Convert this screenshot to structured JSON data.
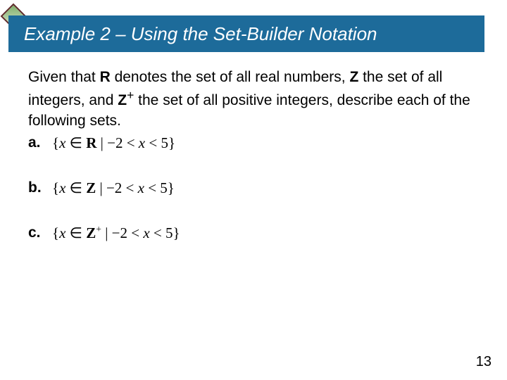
{
  "title": "Example 2 – Using the Set-Builder Notation",
  "intro_html": "Given that <b>R</b> denotes the set of all real numbers, <b>Z</b> the set of all integers, and <b>Z</b><sup>+</sup> the set of all positive integers, describe each of the following sets.",
  "items": {
    "a": {
      "label": "a.",
      "set_html": "{<i>x</i> &isin; <b>R</b> | &minus;2 &lt; <i>x</i> &lt; 5}"
    },
    "b": {
      "label": "b.",
      "set_html": "{<i>x</i> &isin; <b>Z</b> | &minus;2 &lt; <i>x</i> &lt; 5}"
    },
    "c": {
      "label": "c.",
      "set_html": "{<i>x</i> &isin; <b>Z</b><sup>+</sup> | &minus;2 &lt; <i>x</i> &lt; 5}"
    }
  },
  "page_number": "13"
}
